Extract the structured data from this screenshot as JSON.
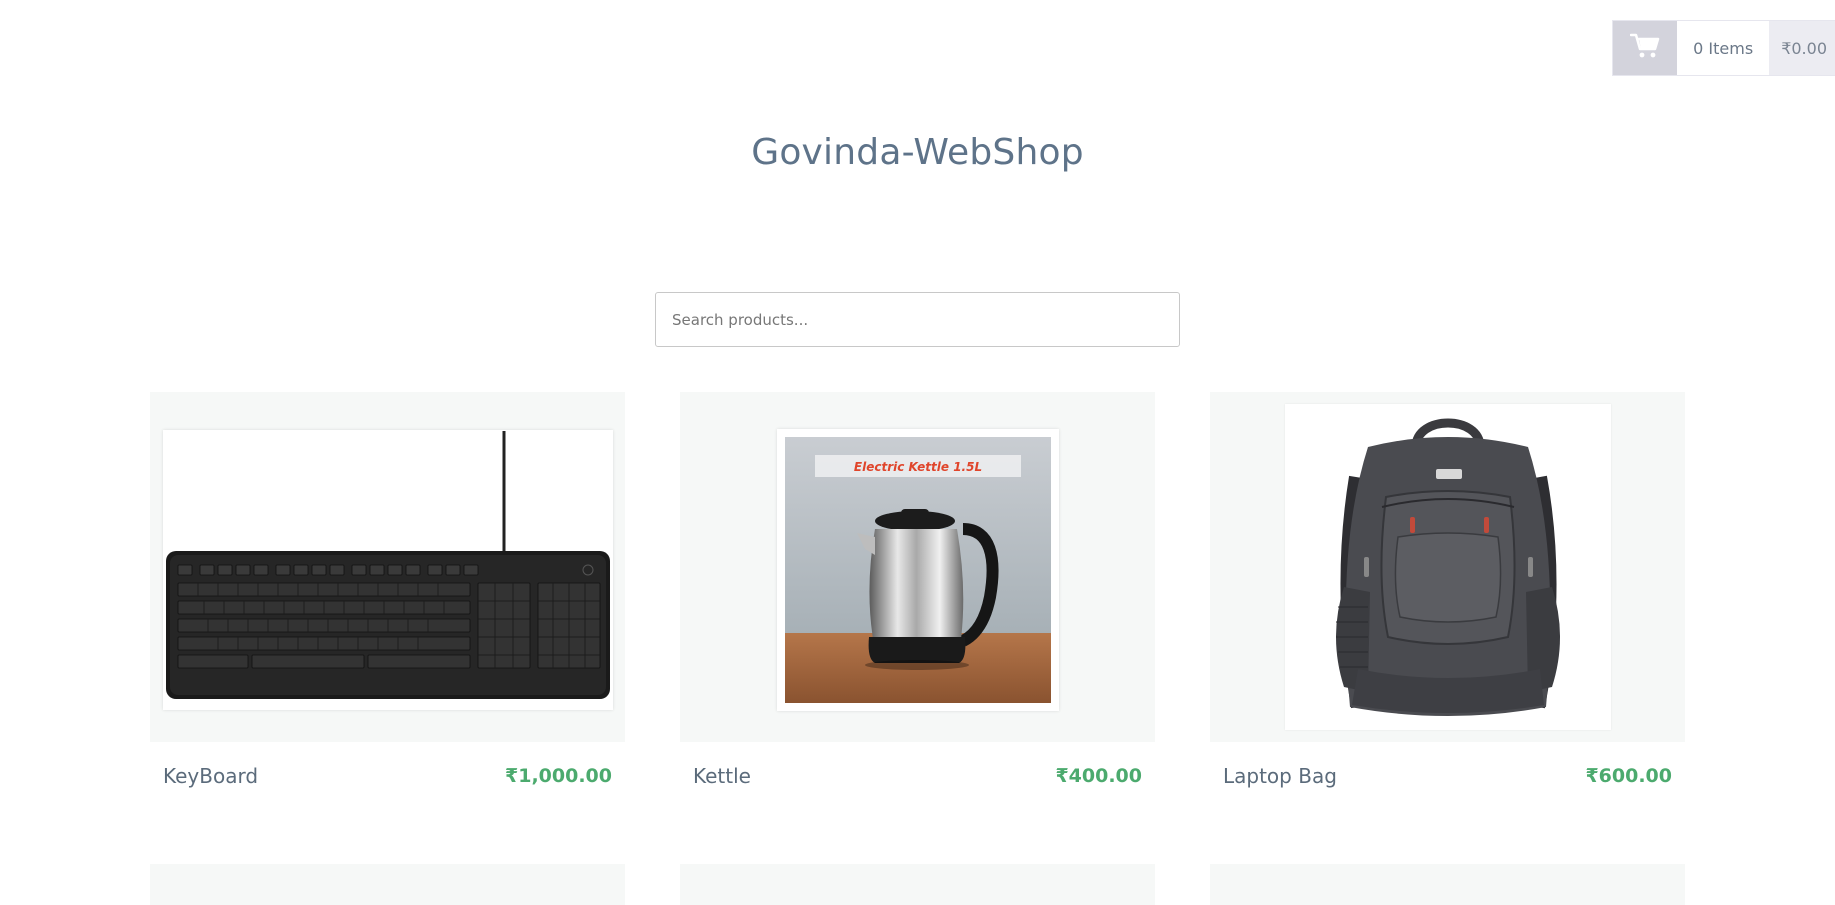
{
  "cart": {
    "icon": "cart-icon",
    "count_label": "0 Items",
    "total_label": "₹0.00"
  },
  "header": {
    "title": "Govinda-WebShop"
  },
  "search": {
    "placeholder": "Search products..."
  },
  "products": [
    {
      "name": "KeyBoard",
      "price": "₹1,000.00",
      "image": "keyboard-image"
    },
    {
      "name": "Kettle",
      "price": "₹400.00",
      "image": "kettle-image",
      "image_caption": "Electric Kettle 1.5L"
    },
    {
      "name": "Laptop Bag",
      "price": "₹600.00",
      "image": "laptop-bag-image"
    }
  ],
  "colors": {
    "price": "#4caa6e",
    "title": "#5e7389",
    "card_bg": "#f6f8f7",
    "cart_button": "#d3d3dc"
  }
}
